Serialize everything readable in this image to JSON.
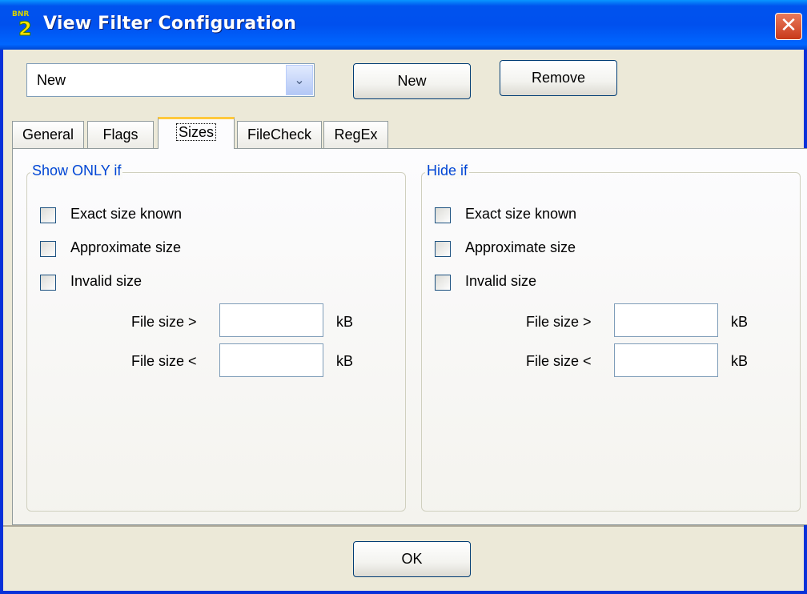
{
  "window": {
    "title": "View Filter Configuration",
    "icon": "bnr2-app-icon",
    "icon_text_top": "BNR",
    "icon_text_main": "2",
    "close_symbol": "✕"
  },
  "toolbar": {
    "filter_select": {
      "value": "New",
      "arrow": "⌄"
    },
    "new_label": "New",
    "remove_label": "Remove"
  },
  "tabs": [
    {
      "label": "General",
      "active": false
    },
    {
      "label": "Flags",
      "active": false
    },
    {
      "label": "Sizes",
      "active": true
    },
    {
      "label": "FileCheck",
      "active": false
    },
    {
      "label": "RegEx",
      "active": false
    }
  ],
  "show_group": {
    "title": "Show ONLY if",
    "checks": [
      {
        "label": "Exact size known",
        "checked": false
      },
      {
        "label": "Approximate size",
        "checked": false
      },
      {
        "label": "Invalid size",
        "checked": false
      }
    ],
    "gt_label": "File size >",
    "gt_value": "",
    "lt_label": "File size <",
    "lt_value": "",
    "unit": "kB"
  },
  "hide_group": {
    "title": "Hide if",
    "checks": [
      {
        "label": "Exact size known",
        "checked": false
      },
      {
        "label": "Approximate size",
        "checked": false
      },
      {
        "label": "Invalid size",
        "checked": false
      }
    ],
    "gt_label": "File size >",
    "gt_value": "",
    "lt_label": "File size <",
    "lt_value": "",
    "unit": "kB"
  },
  "footer": {
    "ok_label": "OK"
  },
  "colors": {
    "titlebar": "#0054e3",
    "group_title": "#0046d5",
    "active_tab_highlight": "#ffc83c",
    "dialog_bg": "#ece9d8"
  }
}
